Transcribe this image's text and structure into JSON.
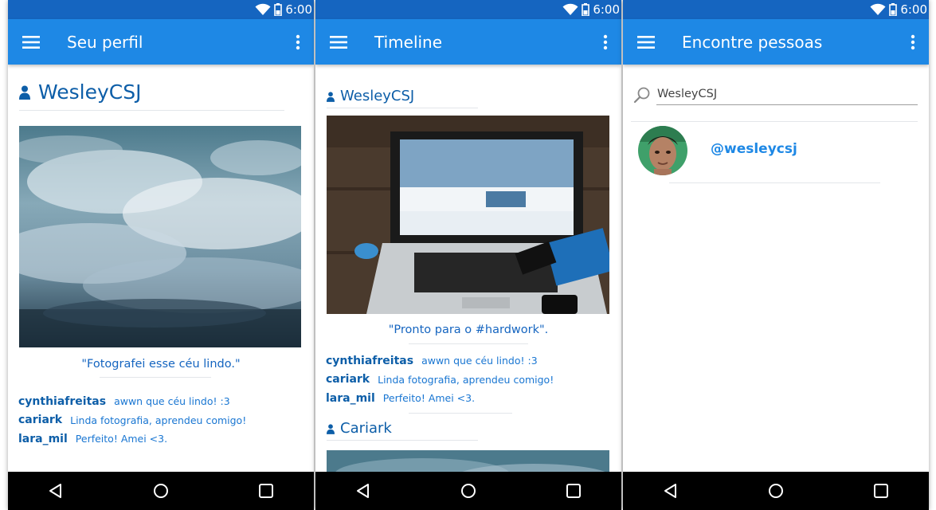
{
  "status": {
    "time": "6:00"
  },
  "profile": {
    "title": "Seu perfil",
    "username": "WesleyCSJ",
    "caption": "\"Fotografei esse céu lindo.\"",
    "comments": [
      {
        "user": "cynthiafreitas",
        "text": "awwn que céu lindo! :3"
      },
      {
        "user": "cariark",
        "text": "Linda fotografia, aprendeu comigo!"
      },
      {
        "user": "lara_mil",
        "text": "Perfeito! Amei <3."
      }
    ]
  },
  "timeline": {
    "title": "Timeline",
    "posts": [
      {
        "author": "WesleyCSJ",
        "caption": "\"Pronto para o #hardwork\".",
        "comments": [
          {
            "user": "cynthiafreitas",
            "text": "awwn que céu lindo! :3"
          },
          {
            "user": "cariark",
            "text": "Linda fotografia, aprendeu comigo!"
          },
          {
            "user": "lara_mil",
            "text": "Perfeito! Amei <3."
          }
        ]
      },
      {
        "author": "Cariark"
      }
    ]
  },
  "search": {
    "title": "Encontre pessoas",
    "query": "WesleyCSJ",
    "results": [
      {
        "handle": "@wesleycsj"
      }
    ]
  },
  "colors": {
    "statusbar": "#1565C0",
    "appbar": "#1E88E5",
    "accent_text": "#0D5EA8",
    "navbar": "#000000"
  },
  "icons": [
    "wifi-icon",
    "battery-icon",
    "menu-icon",
    "more-vert-icon",
    "person-icon",
    "search-icon",
    "back-icon",
    "home-icon",
    "recents-icon"
  ]
}
